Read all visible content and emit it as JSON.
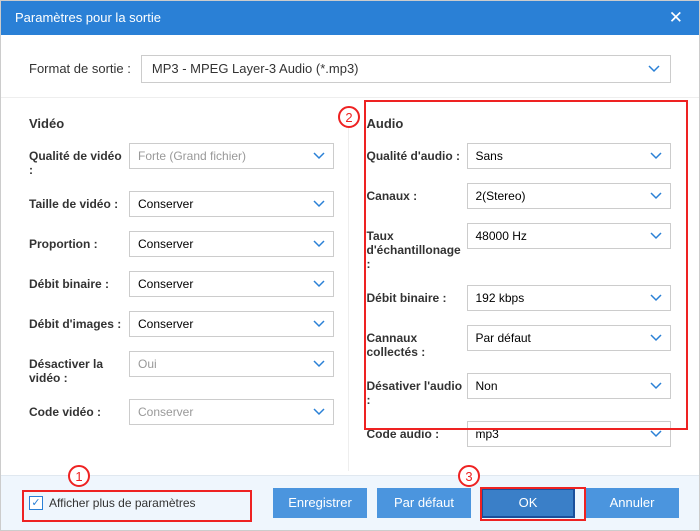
{
  "title": "Paramètres pour la sortie",
  "format_label": "Format de sortie :",
  "format_value": "MP3 - MPEG Layer-3 Audio (*.mp3)",
  "video": {
    "heading": "Vidéo",
    "fields": {
      "quality": {
        "label": "Qualité de vidéo :",
        "value": "Forte (Grand fichier)"
      },
      "size": {
        "label": "Taille de vidéo :",
        "value": "Conserver"
      },
      "ratio": {
        "label": "Proportion :",
        "value": "Conserver"
      },
      "bitrate": {
        "label": "Débit binaire :",
        "value": "Conserver"
      },
      "fps": {
        "label": "Débit d'images :",
        "value": "Conserver"
      },
      "disable": {
        "label": "Désactiver la vidéo :",
        "value": "Oui"
      },
      "codec": {
        "label": "Code vidéo :",
        "value": "Conserver"
      }
    }
  },
  "audio": {
    "heading": "Audio",
    "fields": {
      "quality": {
        "label": "Qualité d'audio :",
        "value": "Sans"
      },
      "channels": {
        "label": "Canaux :",
        "value": "2(Stereo)"
      },
      "sample": {
        "label": "Taux d'échantillonage :",
        "value": "48000 Hz"
      },
      "bitrate": {
        "label": "Débit binaire :",
        "value": "192 kbps"
      },
      "collected": {
        "label": "Cannaux collectés :",
        "value": "Par défaut"
      },
      "disable": {
        "label": "Désativer l'audio :",
        "value": "Non"
      },
      "codec": {
        "label": "Code audio :",
        "value": "mp3"
      }
    }
  },
  "footer": {
    "show_more": "Afficher plus de paramètres",
    "save": "Enregistrer",
    "default": "Par défaut",
    "ok": "OK",
    "cancel": "Annuler"
  },
  "markers": {
    "m1": "1",
    "m2": "2",
    "m3": "3"
  }
}
